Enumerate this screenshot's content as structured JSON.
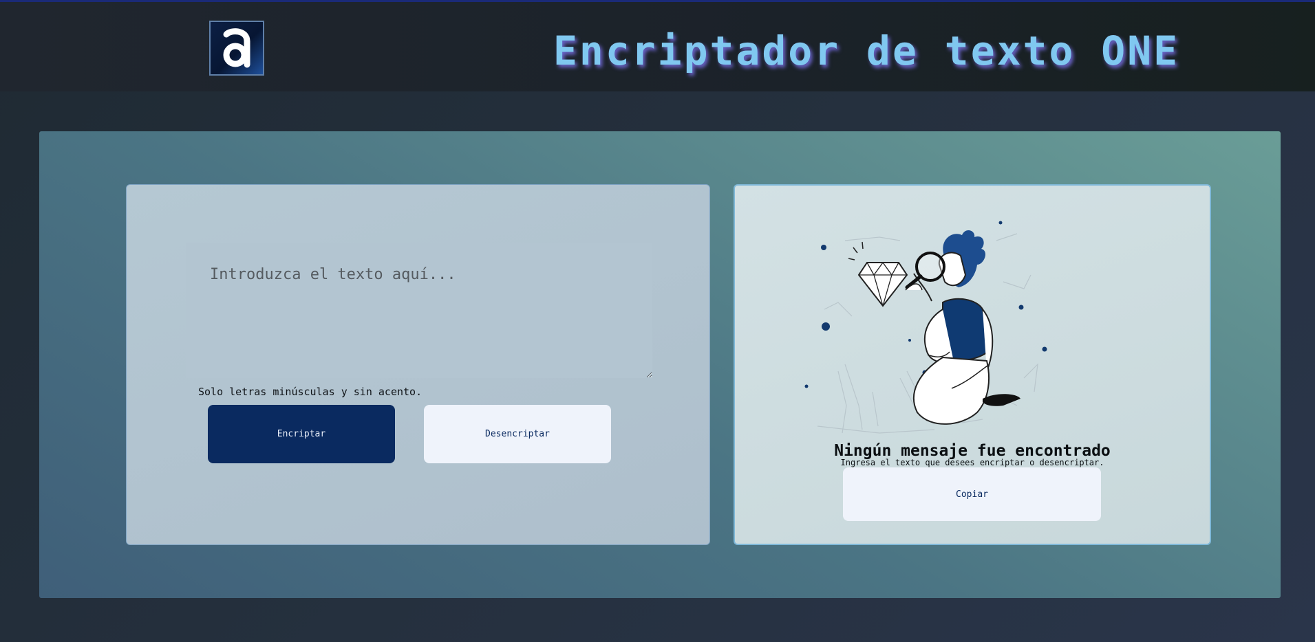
{
  "header": {
    "logo_icon": "alura-a-logo-icon",
    "title": "Encriptador de texto ONE"
  },
  "input": {
    "placeholder": "Introduzca el texto aquí...",
    "value": "",
    "hint": "Solo letras minúsculas y sin acento.",
    "encrypt_label": "Encriptar",
    "decrypt_label": "Desencriptar"
  },
  "output": {
    "illustration": "person-with-magnifying-glass-and-diamond-illustration",
    "empty_title": "Ningún mensaje fue encontrado",
    "empty_subtitle": "Ingresa el texto que desees encriptar o desencriptar.",
    "copy_label": "Copiar"
  },
  "colors": {
    "accent": "#0a2a60",
    "title": "#80c8f0",
    "light_button": "#eff3fb"
  }
}
